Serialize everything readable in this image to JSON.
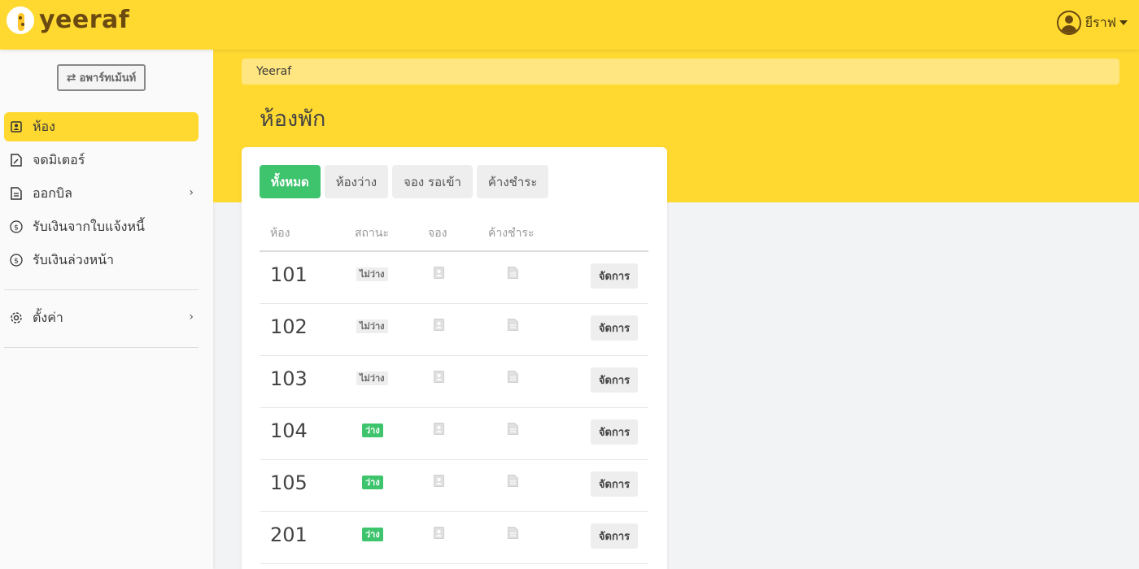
{
  "header": {
    "logo_text": "yeeraf",
    "user_name": "ยีราฟ"
  },
  "sidebar": {
    "apartment_button": "อพาร์ทเม้นท์",
    "items": [
      {
        "label": "ห้อง",
        "icon": "contact-card-icon",
        "active": true
      },
      {
        "label": "จดมิเตอร์",
        "icon": "edit-document-icon"
      },
      {
        "label": "ออกบิล",
        "icon": "document-icon",
        "has_submenu": true
      },
      {
        "label": "รับเงินจากใบแจ้งหนี้",
        "icon": "dollar-circle-icon"
      },
      {
        "label": "รับเงินล่วงหน้า",
        "icon": "dollar-circle-icon"
      }
    ],
    "settings": {
      "label": "ตั้งค่า",
      "icon": "gear-icon",
      "has_submenu": true
    }
  },
  "breadcrumb": "Yeeraf",
  "page_title": "ห้องพัก",
  "tabs": [
    {
      "label": "ทั้งหมด",
      "active": true
    },
    {
      "label": "ห้องว่าง"
    },
    {
      "label": "จอง รอเข้า"
    },
    {
      "label": "ค้างชำระ"
    }
  ],
  "table": {
    "headers": {
      "room": "ห้อง",
      "status": "สถานะ",
      "booking": "จอง",
      "overdue": "ค้างชำระ"
    },
    "manage_label": "จัดการ",
    "rows": [
      {
        "room": "101",
        "status": "ไม่ว่าง",
        "state": "busy"
      },
      {
        "room": "102",
        "status": "ไม่ว่าง",
        "state": "busy"
      },
      {
        "room": "103",
        "status": "ไม่ว่าง",
        "state": "busy"
      },
      {
        "room": "104",
        "status": "ว่าง",
        "state": "free"
      },
      {
        "room": "105",
        "status": "ว่าง",
        "state": "free"
      },
      {
        "room": "201",
        "status": "ว่าง",
        "state": "free"
      }
    ]
  },
  "colors": {
    "brand_yellow": "#ffd930",
    "success_green": "#3ec46d"
  }
}
